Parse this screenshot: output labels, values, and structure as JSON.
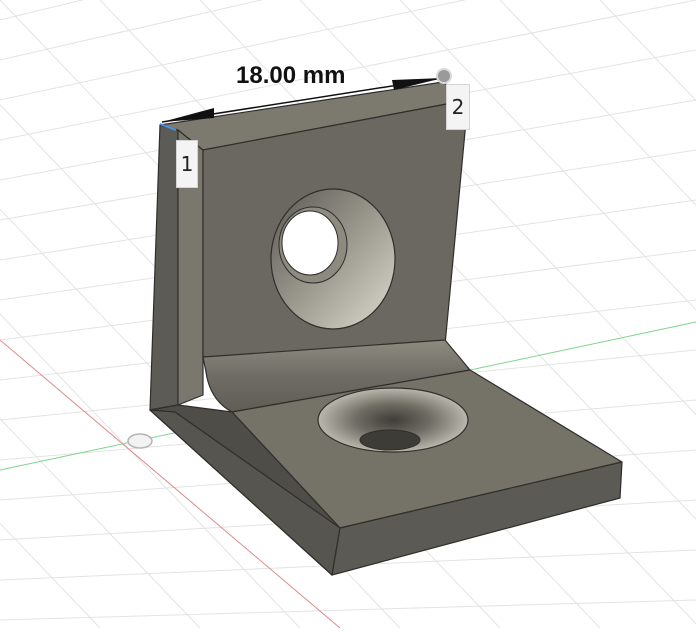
{
  "viewport": {
    "dimension_label": "18.00 mm",
    "point_1_label": "1",
    "point_2_label": "2"
  },
  "colors": {
    "grid_line": "#e3e3e3",
    "x_axis": "#e08a8a",
    "y_axis": "#7fd48a",
    "body": "#6b6962",
    "body_light": "#888578",
    "body_dark": "#4f4d47",
    "background": "#ffffff"
  }
}
